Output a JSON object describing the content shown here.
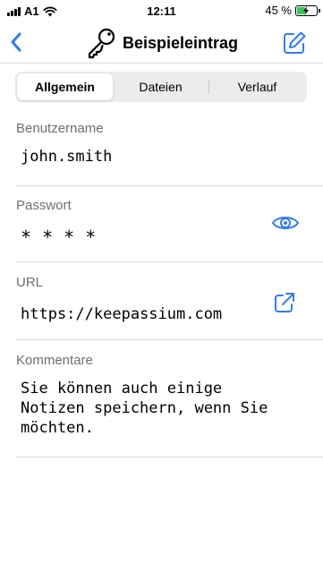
{
  "status_bar": {
    "carrier": "A1",
    "time": "12:11",
    "battery": "45 %",
    "battery_level": 0.45
  },
  "nav": {
    "title": "Beispieleintrag",
    "back_icon": "chevron-left-icon",
    "title_icon": "key-icon",
    "edit_icon": "edit-icon"
  },
  "tabs": [
    {
      "label": "Allgemein",
      "active": true
    },
    {
      "label": "Dateien",
      "active": false
    },
    {
      "label": "Verlauf",
      "active": false
    }
  ],
  "fields": {
    "username": {
      "label": "Benutzername",
      "value": "john.smith"
    },
    "password": {
      "label": "Passwort",
      "value": "* * * *",
      "action_icon": "eye-icon"
    },
    "url": {
      "label": "URL",
      "value": "https://keepassium.com",
      "action_icon": "open-link-icon"
    },
    "notes": {
      "label": "Kommentare",
      "value": "Sie können auch einige\nNotizen speichern, wenn Sie\nmöchten."
    }
  },
  "colors": {
    "accent": "#2f7cf6",
    "label_gray": "#6e6e73",
    "separator": "#d8d8dc",
    "battery_green": "#34c759"
  }
}
